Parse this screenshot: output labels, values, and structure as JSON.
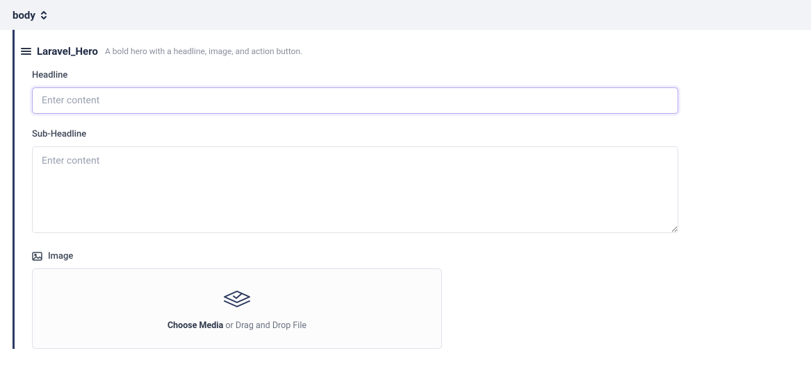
{
  "topbar": {
    "title": "body"
  },
  "block": {
    "title": "Laravel_Hero",
    "description": "A bold hero with a headline, image, and action button."
  },
  "fields": {
    "headline": {
      "label": "Headline",
      "placeholder": "Enter content",
      "value": ""
    },
    "subheadline": {
      "label": "Sub-Headline",
      "placeholder": "Enter content",
      "value": ""
    },
    "image": {
      "label": "Image",
      "choose_label": "Choose Media",
      "drag_label": " or Drag and Drop File"
    }
  }
}
